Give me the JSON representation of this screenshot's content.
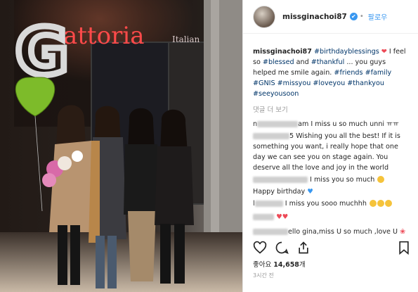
{
  "photo": {
    "sign_text": "attoria",
    "sign_small": "Italian",
    "balloon_letter": "G"
  },
  "header": {
    "username": "missginachoi87",
    "verified_glyph": "✔",
    "separator": "•",
    "follow_label": "팔로우"
  },
  "caption": {
    "username": "missginachoi87",
    "tag1": "#birthdayblessings",
    "heart": "❤",
    "text1": " I feel so ",
    "tag2": "#blessed",
    "text2": " and ",
    "tag3": "#thankful",
    "text3": " ... you guys helped me smile again. ",
    "tag4": "#friends",
    "tag5": "#family",
    "tag6": "#GNIS",
    "tag7": "#missyou",
    "tag8": "#loveyou",
    "tag9": "#thankyou",
    "tag10": "#seeyousoon"
  },
  "view_more": "댓글 더 보기",
  "comments": [
    {
      "prefix": "n",
      "text": "am I miss u so much unni ㅠㅠ"
    },
    {
      "prefix": "",
      "text": "5 Wishing you all the best! If it is something you want, i really hope that one day we can see you on stage again. You deserve all the love and joy in the world"
    },
    {
      "prefix": "",
      "text": "I miss you so much"
    },
    {
      "prefix": "",
      "text": "Happy birthday"
    },
    {
      "prefix": "l",
      "text": "I miss you sooo muchhh"
    },
    {
      "prefix": "",
      "text": "ello gina,miss U so much ,love U"
    }
  ],
  "likes": {
    "prefix": "좋아요 ",
    "count": "14,658",
    "suffix": "개"
  },
  "time": "3시간 전",
  "icons": {
    "like": "heart-outline-icon",
    "comment": "comment-bubble-icon",
    "share": "share-icon",
    "save": "bookmark-icon"
  },
  "colors": {
    "accent": "#3897f0",
    "hashtag": "#003569",
    "heart": "#ed4956"
  }
}
